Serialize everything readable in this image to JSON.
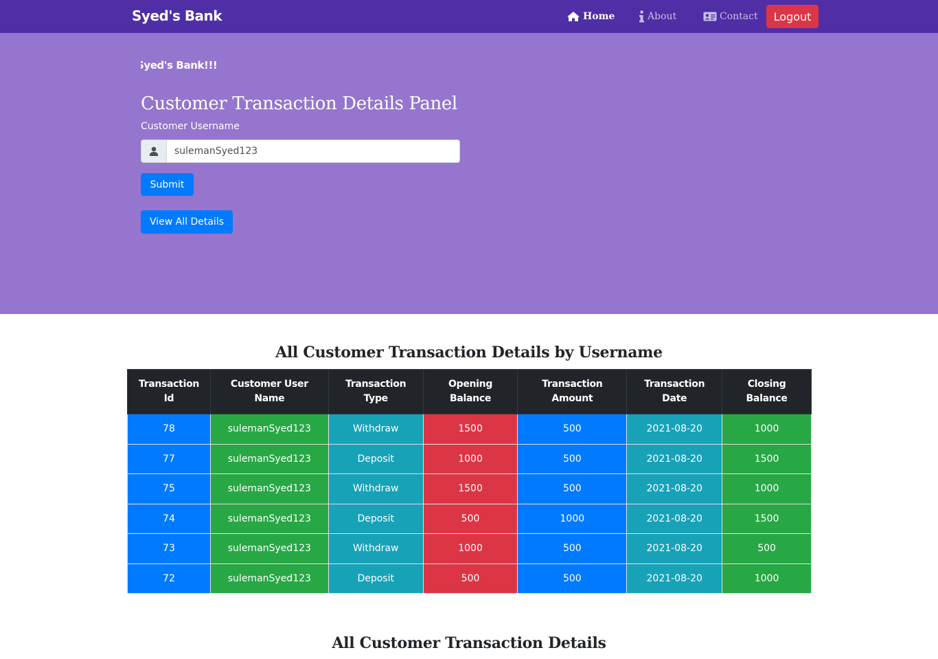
{
  "navbar": {
    "brand": "Syed's Bank",
    "links": [
      {
        "label": "Home",
        "icon": "home-icon"
      },
      {
        "label": "About",
        "icon": "info-icon"
      },
      {
        "label": "Contact",
        "icon": "id-card-icon"
      }
    ],
    "logout_label": "Logout"
  },
  "hero": {
    "marquee_text": "Syed's Bank!!!",
    "panel_title": "Customer Transaction Details Panel",
    "username_label": "Customer Username",
    "username_value": "sulemanSyed123",
    "submit_label": "Submit",
    "view_all_label": "View All Details"
  },
  "table1": {
    "title": "All Customer Transaction Details by Username",
    "headers": [
      "Transaction Id",
      "Customer User Name",
      "Transaction Type",
      "Opening Balance",
      "Transaction Amount",
      "Transaction Date",
      "Closing Balance"
    ],
    "rows": [
      [
        "78",
        "sulemanSyed123",
        "Withdraw",
        "1500",
        "500",
        "2021-08-20",
        "1000"
      ],
      [
        "77",
        "sulemanSyed123",
        "Deposit",
        "1000",
        "500",
        "2021-08-20",
        "1500"
      ],
      [
        "75",
        "sulemanSyed123",
        "Withdraw",
        "1500",
        "500",
        "2021-08-20",
        "1000"
      ],
      [
        "74",
        "sulemanSyed123",
        "Deposit",
        "500",
        "1000",
        "2021-08-20",
        "1500"
      ],
      [
        "73",
        "sulemanSyed123",
        "Withdraw",
        "1000",
        "500",
        "2021-08-20",
        "500"
      ],
      [
        "72",
        "sulemanSyed123",
        "Deposit",
        "500",
        "500",
        "2021-08-20",
        "1000"
      ]
    ]
  },
  "table2": {
    "title": "All Customer Transaction Details"
  },
  "colors": {
    "navbar": "#4f2ea6",
    "hero": "#9575cd",
    "primary": "#007bff",
    "danger": "#dc3545",
    "success": "#28a745",
    "info": "#17a2b8",
    "dark": "#212529"
  }
}
